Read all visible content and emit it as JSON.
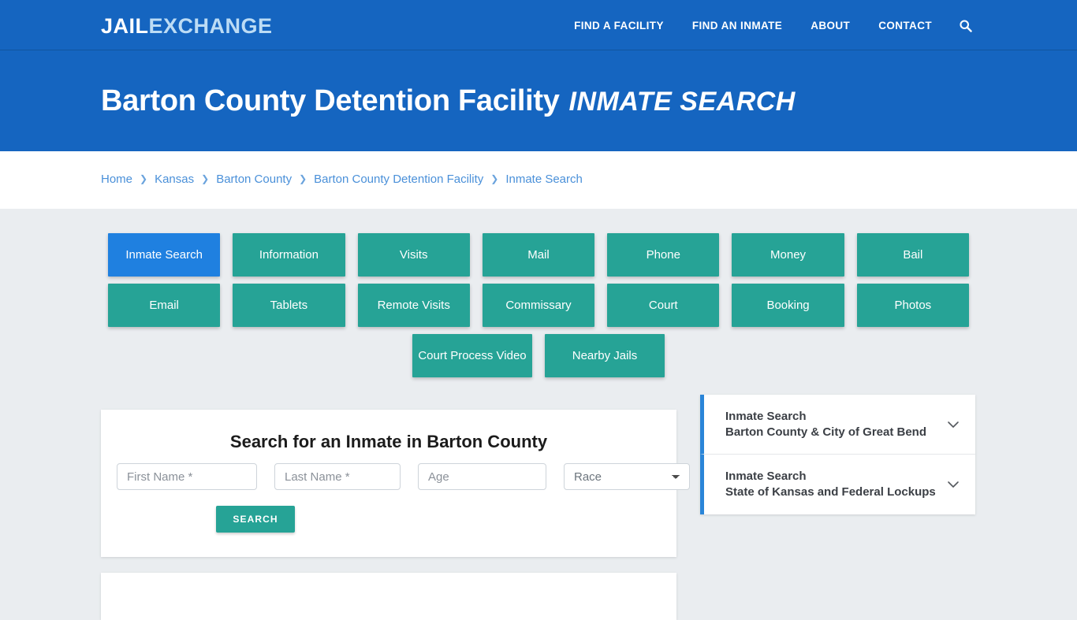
{
  "navbar": {
    "logo_primary": "JAIL",
    "logo_secondary": "EXCHANGE",
    "links": [
      {
        "label": "FIND A FACILITY"
      },
      {
        "label": "FIND AN INMATE"
      },
      {
        "label": "ABOUT"
      },
      {
        "label": "CONTACT"
      }
    ],
    "search_icon": "search-icon"
  },
  "hero": {
    "title_main": "Barton County Detention Facility",
    "title_sub": "INMATE SEARCH"
  },
  "breadcrumb": {
    "separator": "❯",
    "items": [
      {
        "label": "Home"
      },
      {
        "label": "Kansas"
      },
      {
        "label": "Barton County"
      },
      {
        "label": "Barton County Detention Facility"
      },
      {
        "label": "Inmate Search"
      }
    ]
  },
  "tabs": {
    "row1": [
      {
        "label": "Inmate Search",
        "active": true
      },
      {
        "label": "Information",
        "active": false
      },
      {
        "label": "Visits",
        "active": false
      },
      {
        "label": "Mail",
        "active": false
      },
      {
        "label": "Phone",
        "active": false
      },
      {
        "label": "Money",
        "active": false
      },
      {
        "label": "Bail",
        "active": false
      }
    ],
    "row2": [
      {
        "label": "Email",
        "active": false
      },
      {
        "label": "Tablets",
        "active": false
      },
      {
        "label": "Remote Visits",
        "active": false
      },
      {
        "label": "Commissary",
        "active": false
      },
      {
        "label": "Court",
        "active": false
      },
      {
        "label": "Booking",
        "active": false
      },
      {
        "label": "Photos",
        "active": false
      }
    ],
    "row3": [
      {
        "label": "Court Process Video",
        "active": false
      },
      {
        "label": "Nearby Jails",
        "active": false
      }
    ]
  },
  "search_form": {
    "title": "Search for an Inmate in Barton County",
    "first_name_placeholder": "First Name *",
    "first_name_value": "",
    "last_name_placeholder": "Last Name *",
    "last_name_value": "",
    "age_placeholder": "Age",
    "age_value": "",
    "race_selected": "Race",
    "race_options": [
      "Race"
    ],
    "submit_label": "SEARCH"
  },
  "sidebar": {
    "accordion": [
      {
        "line1": "Inmate Search",
        "line2": "Barton County & City of Great Bend",
        "icon": "chevron-down-icon"
      },
      {
        "line1": "Inmate Search",
        "line2": "State of Kansas and Federal Lockups",
        "icon": "chevron-down-icon"
      }
    ]
  },
  "colors": {
    "brand_blue": "#1565c0",
    "accent_blue": "#1f80e0",
    "teal": "#26a396",
    "link_blue": "#4a90d9",
    "page_bg": "#eaedf0"
  }
}
